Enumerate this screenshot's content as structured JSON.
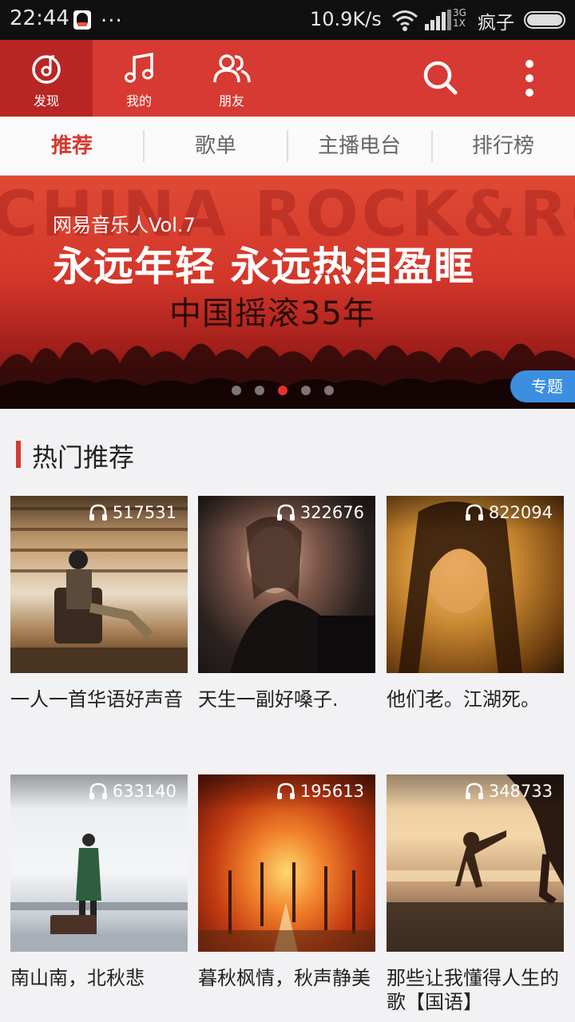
{
  "status_bar": {
    "time": "22:44",
    "dots": "...",
    "speed": "10.9K/s",
    "network_top": "3G",
    "network_bottom": "1X",
    "carrier": "疯子"
  },
  "top_tabs": [
    {
      "label": "发现",
      "icon": "netease-logo-icon",
      "active": true
    },
    {
      "label": "我的",
      "icon": "music-note-icon",
      "active": false
    },
    {
      "label": "朋友",
      "icon": "friends-icon",
      "active": false
    }
  ],
  "sub_tabs": [
    {
      "label": "推荐",
      "active": true
    },
    {
      "label": "歌单",
      "active": false
    },
    {
      "label": "主播电台",
      "active": false
    },
    {
      "label": "排行榜",
      "active": false
    }
  ],
  "banner": {
    "bg_text": "CHINA ROCK&ROLL",
    "line1": "网易音乐人Vol.7",
    "line2": "永远年轻 永远热泪盈眶",
    "line3": "中国摇滚35年",
    "tag": "专题",
    "active_dot": 2,
    "dot_count": 5
  },
  "section": {
    "title": "热门推荐"
  },
  "playlists": [
    {
      "plays": "517531",
      "name": "一人一首华语好声音"
    },
    {
      "plays": "322676",
      "name": "天生一副好嗓子."
    },
    {
      "plays": "822094",
      "name": "他们老。江湖死。"
    },
    {
      "plays": "633140",
      "name": "南山南，北秋悲"
    },
    {
      "plays": "195613",
      "name": "暮秋枫情，秋声静美"
    },
    {
      "plays": "348733",
      "name": "那些让我懂得人生的歌【国语】"
    }
  ],
  "colors": {
    "brand_red": "#d73a32",
    "active_tab_red": "#b82624",
    "tag_blue": "#3c8fe0"
  }
}
